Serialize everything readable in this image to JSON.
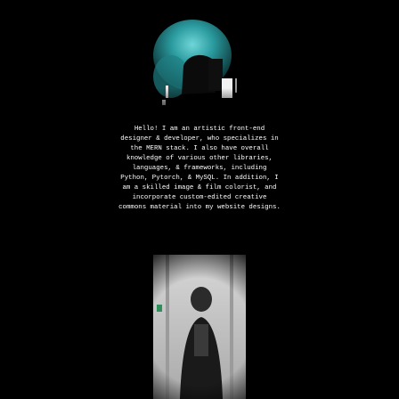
{
  "profile": {
    "bio_text": "Hello! I am an artistic front-end\ndesigner & developer, who specializes in\nthe MERN stack. I also have overall\nknowledge of various other libraries,\nlanguages, & frameworks, including\nPython, Pytorch, & MySQL. In addition, I\nam a skilled image & film colorist, and\nincorporate custom-edited creative\ncommons material into my website designs."
  },
  "colors": {
    "background": "#000000",
    "text": "#ffffff",
    "accent_teal": "#2a9a9e",
    "photo_gray": "#c7c7c7"
  }
}
